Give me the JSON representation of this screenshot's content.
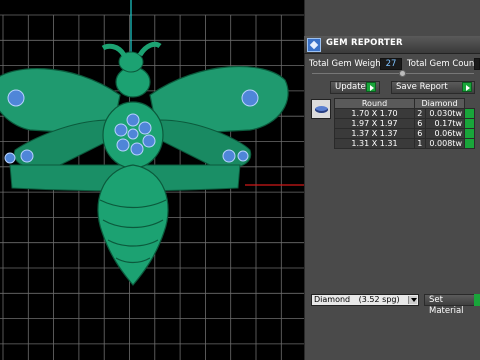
{
  "window": {
    "title": "GEM REPORTER"
  },
  "weight": {
    "label": "Total Gem Weight",
    "value": "27"
  },
  "count": {
    "label": "Total Gem Count"
  },
  "buttons": {
    "update": "Update",
    "save_report": "Save Report",
    "set_material": "Set Material"
  },
  "table": {
    "headers": [
      "Round",
      "Diamond"
    ],
    "rows": [
      {
        "size": "1.70 X 1.70",
        "count": "2",
        "weight": "0.030tw"
      },
      {
        "size": "1.97 X 1.97",
        "count": "6",
        "weight": "0.17tw"
      },
      {
        "size": "1.37 X 1.37",
        "count": "6",
        "weight": "0.06tw"
      },
      {
        "size": "1.31 X 1.31",
        "count": "1",
        "weight": "0.008tw"
      }
    ]
  },
  "material": {
    "name": "Diamond",
    "spg": "(3.52 spg)"
  },
  "colors": {
    "panel": "#4a4a4a",
    "accent_green": "#19a53a",
    "model_green": "#1a8f6a",
    "value_text": "#7fc3ff",
    "grid": "#6d6d6d"
  },
  "icons": [
    "gem-reporter-logo-icon",
    "round-gem-icon",
    "dropdown-arrow-icon",
    "play-arrow-icon"
  ]
}
